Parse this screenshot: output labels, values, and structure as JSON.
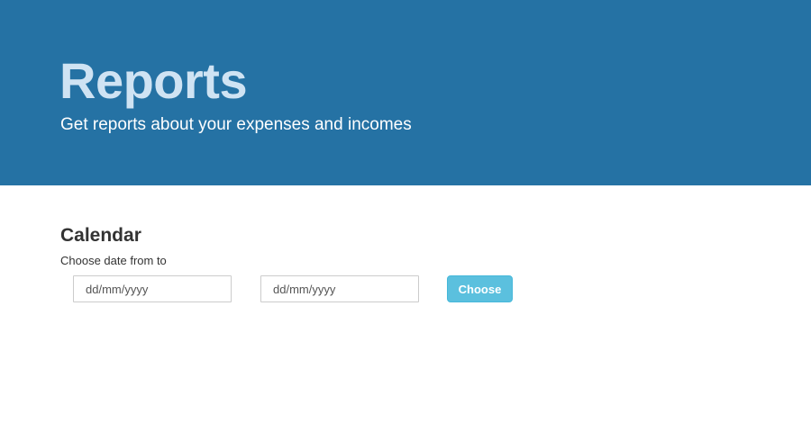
{
  "header": {
    "title": "Reports",
    "subtitle": "Get reports about your expenses and incomes"
  },
  "calendar": {
    "title": "Calendar",
    "label": "Choose date from to",
    "from_placeholder": "dd/mm/yyyy",
    "to_placeholder": "dd/mm/yyyy",
    "button_label": "Choose"
  },
  "colors": {
    "header_bg": "#2572a4",
    "title": "#cfe3f3",
    "button_bg": "#5bc0de"
  }
}
